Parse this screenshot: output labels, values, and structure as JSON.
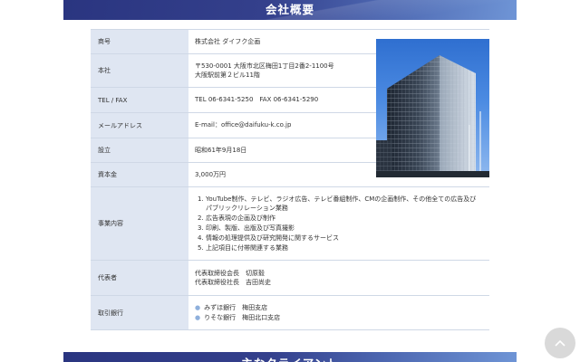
{
  "header": {
    "title": "会社概要"
  },
  "company": {
    "rows": {
      "name": {
        "label": "商号",
        "value": "株式会社 ダイフク企画"
      },
      "address": {
        "label": "本社",
        "line1": "〒530-0001 大阪市北区梅田1丁目2番2-1100号",
        "line2": "大阪駅前第２ビル11階"
      },
      "tel": {
        "label": "TEL / FAX",
        "value": "TEL 06-6341-5250　FAX 06-6341-5290"
      },
      "email": {
        "label": "メールアドレス",
        "value": "E-mail：office@daifuku-k.co.jp"
      },
      "founded": {
        "label": "設立",
        "value": "昭和61年9月18日"
      },
      "capital": {
        "label": "資本金",
        "value": "3,000万円"
      },
      "business": {
        "label": "事業内容",
        "items": [
          {
            "num": "1.",
            "text": "YouTube制作、テレビ、ラジオ広告、テレビ番組制作、CMの企画制作、その他全ての広告及びパブリックリレーション業務"
          },
          {
            "num": "2.",
            "text": "広告表現の企画及び制作"
          },
          {
            "num": "3.",
            "text": "印刷、製版、出版及び写真撮影"
          },
          {
            "num": "4.",
            "text": "情報の処理提供及び研究開発に関するサービス"
          },
          {
            "num": "5.",
            "text": "上記項目に付帯関連する業務"
          }
        ]
      },
      "representative": {
        "label": "代表者",
        "line1": "代表取締役会長　切原毅",
        "line2": "代表取締役社長　吉田尚史"
      },
      "banks": {
        "label": "取引銀行",
        "items": [
          "みずほ銀行　梅田支店",
          "りそな銀行　梅田北口支店"
        ]
      }
    }
  },
  "next_section": {
    "title": "主なクライアント"
  },
  "icons": {
    "scroll_top": "chevron-up-icon",
    "building_photo": "office-building-photo"
  }
}
